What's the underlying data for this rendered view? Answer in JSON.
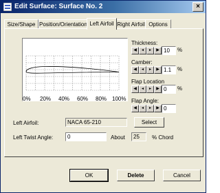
{
  "window": {
    "title": "Edit Surface: Surface No. 2",
    "close_glyph": "×"
  },
  "tabs": [
    "Size/Shape",
    "Position/Orientation",
    "Left Airfoil",
    "Right Airfoil",
    "Options"
  ],
  "active_tab": "Left Airfoil",
  "plot": {
    "x_ticks": [
      "0%",
      "20%",
      "40%",
      "60%",
      "80%",
      "100%"
    ]
  },
  "controls": {
    "thickness": {
      "label": "Thickness:",
      "value": "10",
      "unit": "%"
    },
    "camber": {
      "label": "Camber:",
      "value": "1.1",
      "unit": "%"
    },
    "flap_location": {
      "label": "Flap Location",
      "value": "0",
      "unit": "%"
    },
    "flap_angle": {
      "label": "Flap Angle:",
      "value": "0"
    }
  },
  "spin_glyphs": {
    "left_far": "◀",
    "left": "◂",
    "right": "▸",
    "right_far": "▶"
  },
  "airfoil": {
    "label": "Left Airfoil:",
    "value": "NACA 65-210",
    "select_label": "Select"
  },
  "twist": {
    "label": "Left Twist Angle:",
    "value": "0",
    "about_label": "About",
    "about_value": "25",
    "chord_label": "% Chord"
  },
  "buttons": {
    "ok": "OK",
    "delete": "Delete",
    "cancel": "Cancel"
  },
  "colors": {
    "title_bar": "#0a246a",
    "face": "#ece9d8"
  }
}
